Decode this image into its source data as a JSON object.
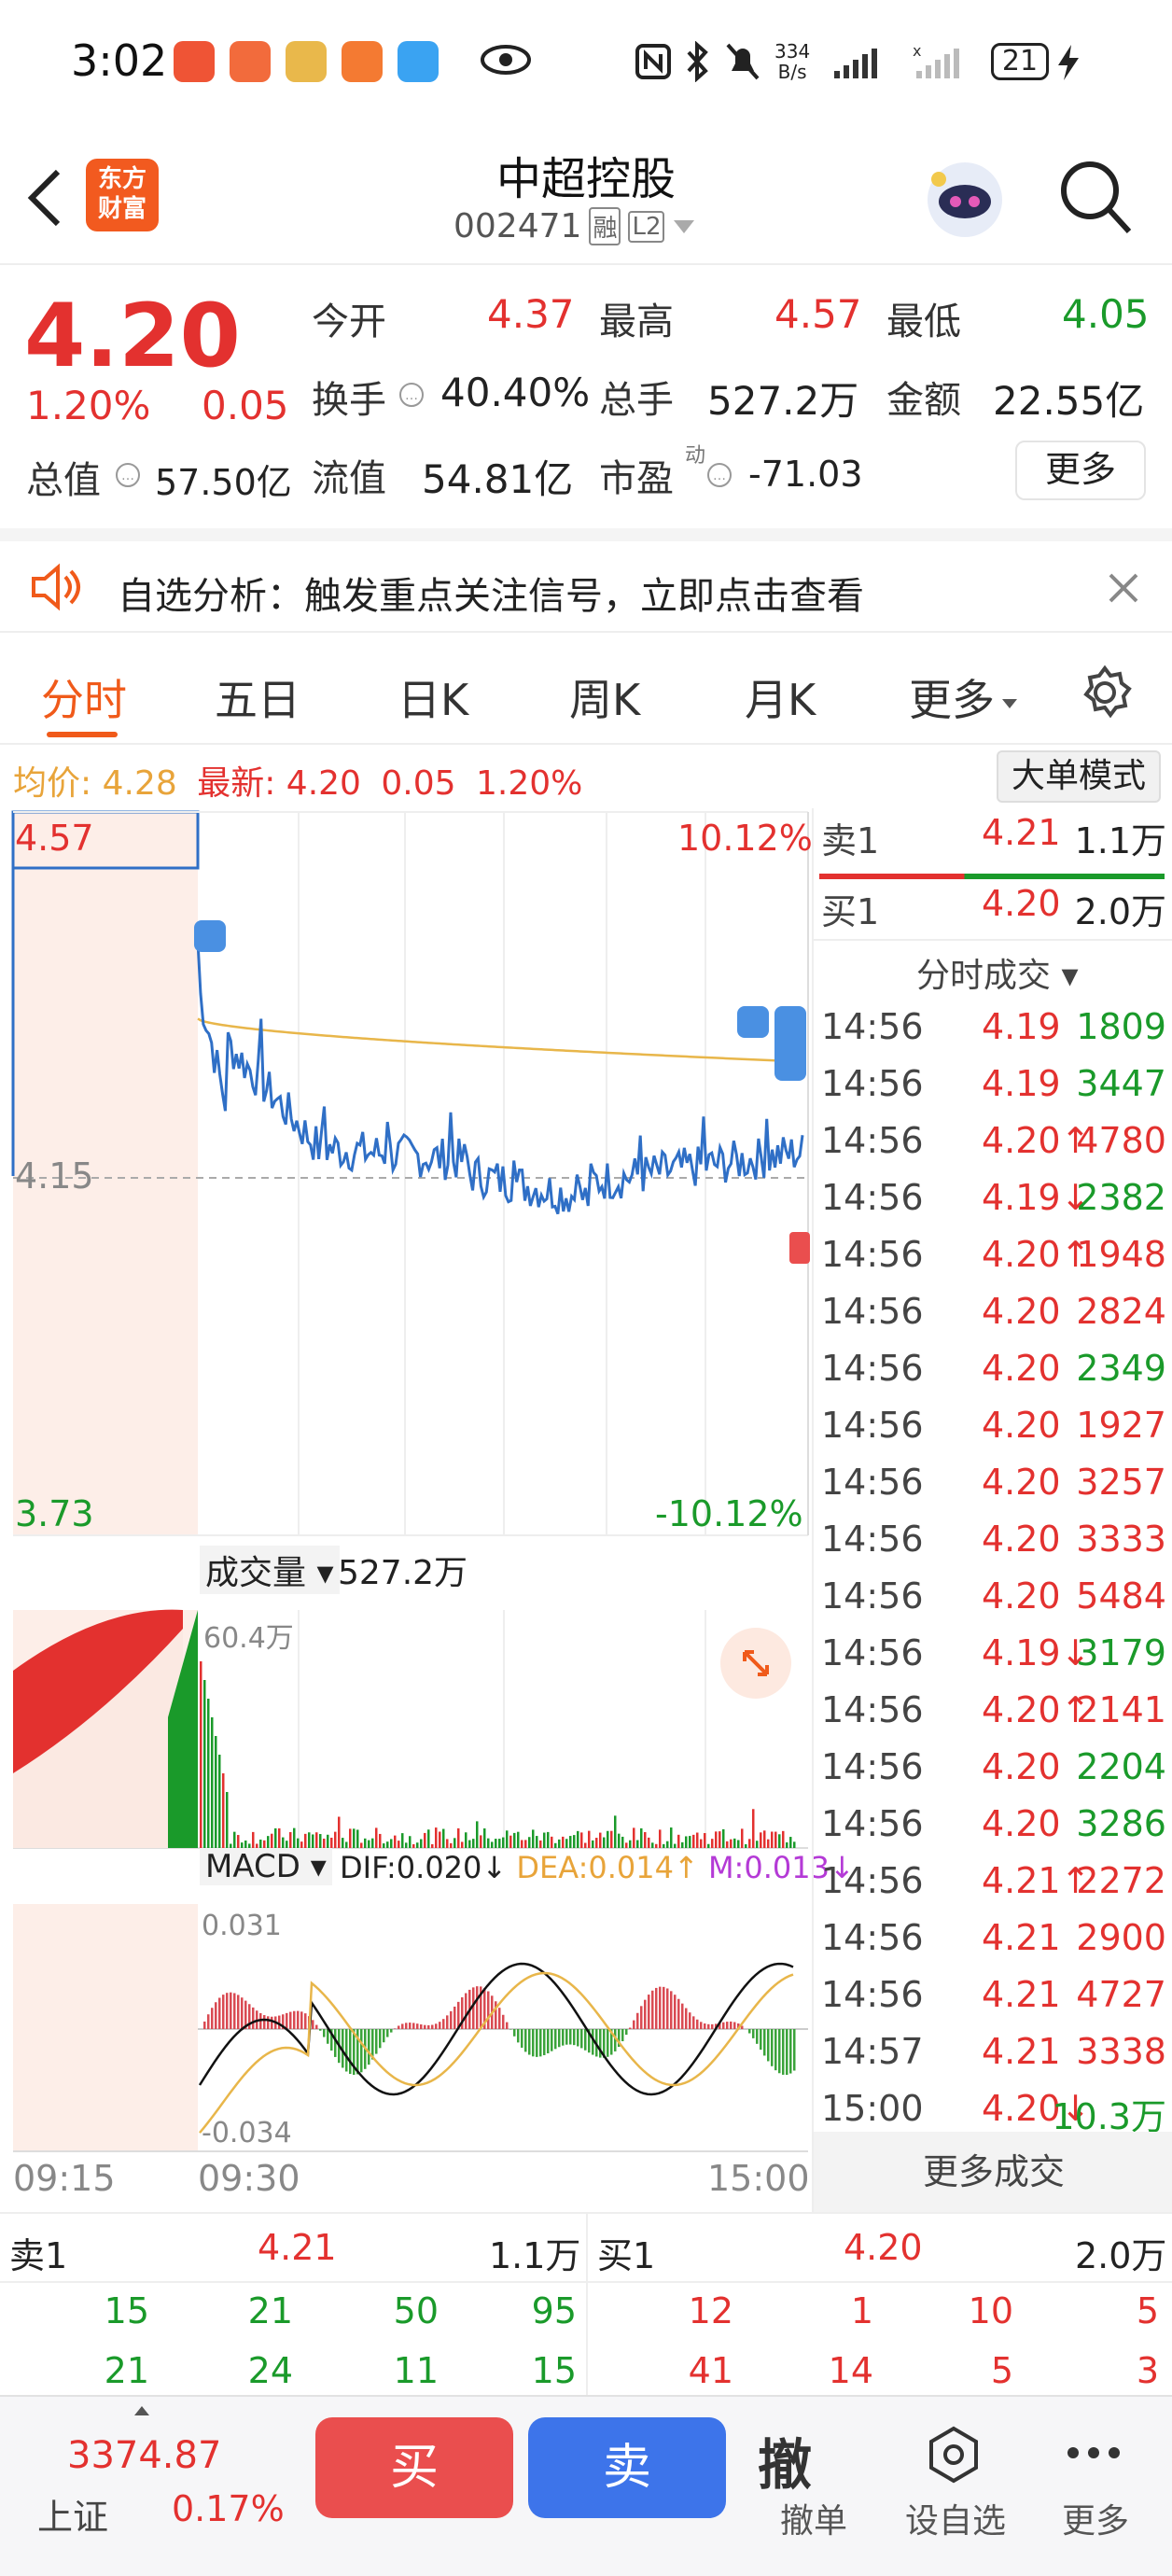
{
  "status_bar": {
    "time": "3:02",
    "net_speed_top": "334",
    "net_speed_bottom": "B/s",
    "battery": "21"
  },
  "header": {
    "logo_line1": "东方",
    "logo_line2": "财富",
    "title": "中超控股",
    "code": "002471",
    "tag_rong": "融",
    "tag_l2": "L2"
  },
  "quote": {
    "price": "4.20",
    "change_pct": "1.20%",
    "change": "0.05",
    "open_label": "今开",
    "open": "4.37",
    "high_label": "最高",
    "high": "4.57",
    "low_label": "最低",
    "low": "4.05",
    "turnover_label": "换手",
    "turnover": "40.40%",
    "volume_label": "总手",
    "volume": "527.2万",
    "amount_label": "金额",
    "amount": "22.55亿",
    "mktcap_label": "总值",
    "mktcap": "57.50亿",
    "float_label": "流值",
    "float": "54.81亿",
    "pe_label": "市盈",
    "pe_sup": "动",
    "pe": "-71.03",
    "more": "更多"
  },
  "banner": {
    "text": "自选分析：触发重点关注信号，立即点击查看"
  },
  "tabs": [
    "分时",
    "五日",
    "日K",
    "周K",
    "月K",
    "更多"
  ],
  "info_line": {
    "avg_label": "均价:",
    "avg": "4.28",
    "latest_label": "最新:",
    "latest": "4.20",
    "chg": "0.05",
    "pct": "1.20%",
    "big_order": "大单模式"
  },
  "chart": {
    "y_top": "4.57",
    "y_mid": "4.15",
    "y_bot": "3.73",
    "pct_top": "10.12%",
    "pct_bot": "-10.12%",
    "vol_label": "成交量",
    "vol_total": "527.2万",
    "vol_max": "60.4万",
    "macd_label": "MACD",
    "dif": "DIF:0.020",
    "dea": "DEA:0.014",
    "m": "M:0.013",
    "macd_top": "0.031",
    "macd_bot": "-0.034",
    "t_start": "09:15",
    "t_open": "09:30",
    "t_end": "15:00"
  },
  "right_panel": {
    "sell1_label": "卖1",
    "sell1_price": "4.21",
    "sell1_vol": "1.1万",
    "buy1_label": "买1",
    "buy1_price": "4.20",
    "buy1_vol": "2.0万",
    "section_title": "分时成交",
    "more_trades": "更多成交",
    "trades": [
      {
        "t": "14:56",
        "p": "4.19",
        "a": "1809",
        "pc": "red",
        "ac": "green",
        "arrow": ""
      },
      {
        "t": "14:56",
        "p": "4.19",
        "a": "3447",
        "pc": "red",
        "ac": "green",
        "arrow": ""
      },
      {
        "t": "14:56",
        "p": "4.20",
        "a": "4780",
        "pc": "red",
        "ac": "red",
        "arrow": "↑"
      },
      {
        "t": "14:56",
        "p": "4.19",
        "a": "2382",
        "pc": "red",
        "ac": "green",
        "arrow": "↓"
      },
      {
        "t": "14:56",
        "p": "4.20",
        "a": "1948",
        "pc": "red",
        "ac": "red",
        "arrow": "↑"
      },
      {
        "t": "14:56",
        "p": "4.20",
        "a": "2824",
        "pc": "red",
        "ac": "red",
        "arrow": ""
      },
      {
        "t": "14:56",
        "p": "4.20",
        "a": "2349",
        "pc": "red",
        "ac": "green",
        "arrow": ""
      },
      {
        "t": "14:56",
        "p": "4.20",
        "a": "1927",
        "pc": "red",
        "ac": "red",
        "arrow": ""
      },
      {
        "t": "14:56",
        "p": "4.20",
        "a": "3257",
        "pc": "red",
        "ac": "red",
        "arrow": ""
      },
      {
        "t": "14:56",
        "p": "4.20",
        "a": "3333",
        "pc": "red",
        "ac": "red",
        "arrow": ""
      },
      {
        "t": "14:56",
        "p": "4.20",
        "a": "5484",
        "pc": "red",
        "ac": "red",
        "arrow": ""
      },
      {
        "t": "14:56",
        "p": "4.19",
        "a": "3179",
        "pc": "red",
        "ac": "green",
        "arrow": "↓"
      },
      {
        "t": "14:56",
        "p": "4.20",
        "a": "2141",
        "pc": "red",
        "ac": "red",
        "arrow": "↑"
      },
      {
        "t": "14:56",
        "p": "4.20",
        "a": "2204",
        "pc": "red",
        "ac": "green",
        "arrow": ""
      },
      {
        "t": "14:56",
        "p": "4.20",
        "a": "3286",
        "pc": "red",
        "ac": "green",
        "arrow": ""
      },
      {
        "t": "14:56",
        "p": "4.21",
        "a": "2272",
        "pc": "red",
        "ac": "red",
        "arrow": "↑"
      },
      {
        "t": "14:56",
        "p": "4.21",
        "a": "2900",
        "pc": "red",
        "ac": "red",
        "arrow": ""
      },
      {
        "t": "14:56",
        "p": "4.21",
        "a": "4727",
        "pc": "red",
        "ac": "red",
        "arrow": ""
      },
      {
        "t": "14:57",
        "p": "4.21",
        "a": "3338",
        "pc": "red",
        "ac": "red",
        "arrow": ""
      },
      {
        "t": "15:00",
        "p": "4.20",
        "a": "10.3万",
        "pc": "red",
        "ac": "green",
        "arrow": "↓"
      }
    ]
  },
  "book": {
    "sell_label": "卖1",
    "sell_price": "4.21",
    "sell_vol": "1.1万",
    "buy_label": "买1",
    "buy_price": "4.20",
    "buy_vol": "2.0万",
    "sell_rows": [
      [
        "15",
        "21",
        "50",
        "95"
      ],
      [
        "21",
        "24",
        "11",
        "15"
      ]
    ],
    "buy_rows": [
      [
        "12",
        "1",
        "10",
        "5"
      ],
      [
        "41",
        "14",
        "5",
        "3"
      ]
    ]
  },
  "bottom": {
    "index_value": "3374.87",
    "index_name": "上证",
    "index_pct": "0.17%",
    "buy": "买",
    "sell": "卖",
    "cancel_icon": "撤",
    "cancel": "撤单",
    "watch": "设自选",
    "more": "更多"
  },
  "colors": {
    "up": "#e3312f",
    "down": "#1a9a2a",
    "price_line": "#2f6fc6",
    "avg_line": "#e8b64a",
    "accent": "#f05a1a",
    "sell_button": "#ea4e4e",
    "buy_button": "#3d74ea"
  }
}
